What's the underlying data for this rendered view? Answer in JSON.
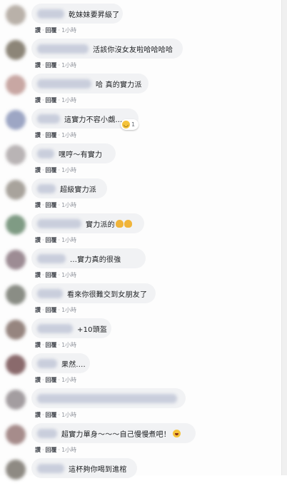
{
  "actions": {
    "like": "讚",
    "sep": "·",
    "reply": "回覆",
    "time": "1小時"
  },
  "comments": [
    {
      "text": "乾妹妹要昇級了"
    },
    {
      "text": "活該你沒女友啦哈哈哈哈"
    },
    {
      "text": "哈 真的實力派"
    },
    {
      "text": "這實力不容小覷……",
      "reaction_count": "1"
    },
    {
      "text": "嘿哼～有實力"
    },
    {
      "text": "超級實力派"
    },
    {
      "text": "實力派的"
    },
    {
      "text": "...實力真的很強"
    },
    {
      "text": "看來你很難交到女朋友了"
    },
    {
      "text": "+10頭盔"
    },
    {
      "text": "果然...."
    },
    {
      "text": ""
    },
    {
      "text": "超實力單身～～～自己慢慢煮吧！"
    },
    {
      "text": "這杯夠你喝到進棺"
    }
  ],
  "colors": {
    "bubble": "#f1f2f4",
    "action_text": "#4b4f56",
    "timestamp": "#90949c"
  }
}
